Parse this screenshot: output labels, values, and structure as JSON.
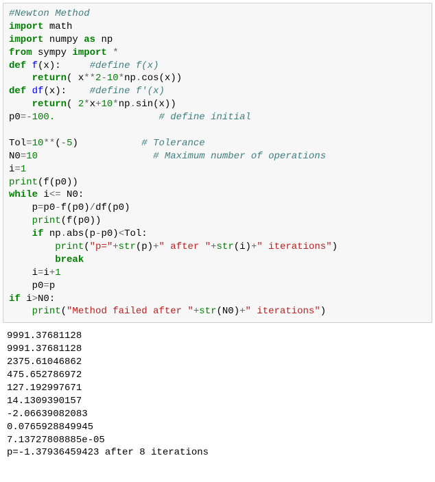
{
  "code": {
    "l01_comment": "#Newton Method",
    "l02_kw1": "import",
    "l02_mod": " math",
    "l03_kw1": "import",
    "l03_mod": " numpy ",
    "l03_kw2": "as",
    "l03_alias": " np",
    "l04_kw1": "from",
    "l04_mod": " sympy ",
    "l04_kw2": "import",
    "l04_sp": " ",
    "l04_star": "*",
    "l05_kw": "def",
    "l05_sp1": " ",
    "l05_fn": "f",
    "l05_args": "(x):     ",
    "l05_comment": "#define f(x)",
    "l06_ind": "    ",
    "l06_kw": "return",
    "l06_a": "( x",
    "l06_op1": "**",
    "l06_n1": "2",
    "l06_op2": "-",
    "l06_n2": "10",
    "l06_op3": "*",
    "l06_b": "np",
    "l06_dot": ".",
    "l06_c": "cos(x))",
    "l07_kw": "def",
    "l07_sp1": " ",
    "l07_fn": "df",
    "l07_args": "(x):    ",
    "l07_comment": "#define f'(x)",
    "l08_ind": "    ",
    "l08_kw": "return",
    "l08_a": "( ",
    "l08_n1": "2",
    "l08_op1": "*",
    "l08_b": "x",
    "l08_op2": "+",
    "l08_n2": "10",
    "l08_op3": "*",
    "l08_c": "np",
    "l08_dot": ".",
    "l08_d": "sin(x))",
    "l09_a": "p0",
    "l09_op1": "=-",
    "l09_n1": "100.",
    "l09_pad": "                  ",
    "l09_comment": "# define initial",
    "l10": "",
    "l11_a": "Tol",
    "l11_op1": "=",
    "l11_n1": "10",
    "l11_op2": "**",
    "l11_b": "(",
    "l11_op3": "-",
    "l11_n2": "5",
    "l11_c": ")",
    "l11_pad": "           ",
    "l11_comment": "# Tolerance",
    "l12_a": "N0",
    "l12_op1": "=",
    "l12_n1": "10",
    "l12_pad": "                    ",
    "l12_comment": "# Maximum number of operations",
    "l13_a": "i",
    "l13_op1": "=",
    "l13_n1": "1",
    "l14_fn": "print",
    "l14_args": "(f(p0))",
    "l15_kw": "while",
    "l15_a": " i",
    "l15_op1": "<=",
    "l15_b": " N0:",
    "l16_ind": "    ",
    "l16_a": "p",
    "l16_op1": "=",
    "l16_b": "p0",
    "l16_op2": "-",
    "l16_c": "f(p0)",
    "l16_op3": "/",
    "l16_d": "df(p0)",
    "l17_ind": "    ",
    "l17_fn": "print",
    "l17_args": "(f(p0))",
    "l18_ind": "    ",
    "l18_kw": "if",
    "l18_a": " np",
    "l18_dot": ".",
    "l18_b": "abs(p",
    "l18_op1": "-",
    "l18_c": "p0)",
    "l18_op2": "<",
    "l18_d": "Tol:",
    "l19_ind": "        ",
    "l19_fn": "print",
    "l19_p1": "(",
    "l19_s1": "\"p=\"",
    "l19_op1": "+",
    "l19_fn2": "str",
    "l19_p2": "(p)",
    "l19_op2": "+",
    "l19_s2": "\" after \"",
    "l19_op3": "+",
    "l19_fn3": "str",
    "l19_p3": "(i)",
    "l19_op4": "+",
    "l19_s3": "\" iterations\"",
    "l19_p4": ")",
    "l20_ind": "        ",
    "l20_kw": "break",
    "l21_ind": "    ",
    "l21_a": "i",
    "l21_op1": "=",
    "l21_b": "i",
    "l21_op2": "+",
    "l21_n1": "1",
    "l22_ind": "    ",
    "l22_a": "p0",
    "l22_op1": "=",
    "l22_b": "p",
    "l23_kw": "if",
    "l23_a": " i",
    "l23_op1": ">",
    "l23_b": "N0:",
    "l24_ind": "    ",
    "l24_fn": "print",
    "l24_p1": "(",
    "l24_s1": "\"Method failed after \"",
    "l24_op1": "+",
    "l24_fn2": "str",
    "l24_p2": "(N0)",
    "l24_op2": "+",
    "l24_s2": "\" iterations\"",
    "l24_p3": ")"
  },
  "output": {
    "l1": "9991.37681128",
    "l2": "9991.37681128",
    "l3": "2375.61046862",
    "l4": "475.652786972",
    "l5": "127.192997671",
    "l6": "14.1309390157",
    "l7": "-2.06639082083",
    "l8": "0.0765928849945",
    "l9": "7.13727808885e-05",
    "l10": "p=-1.37936459423 after 8 iterations"
  }
}
